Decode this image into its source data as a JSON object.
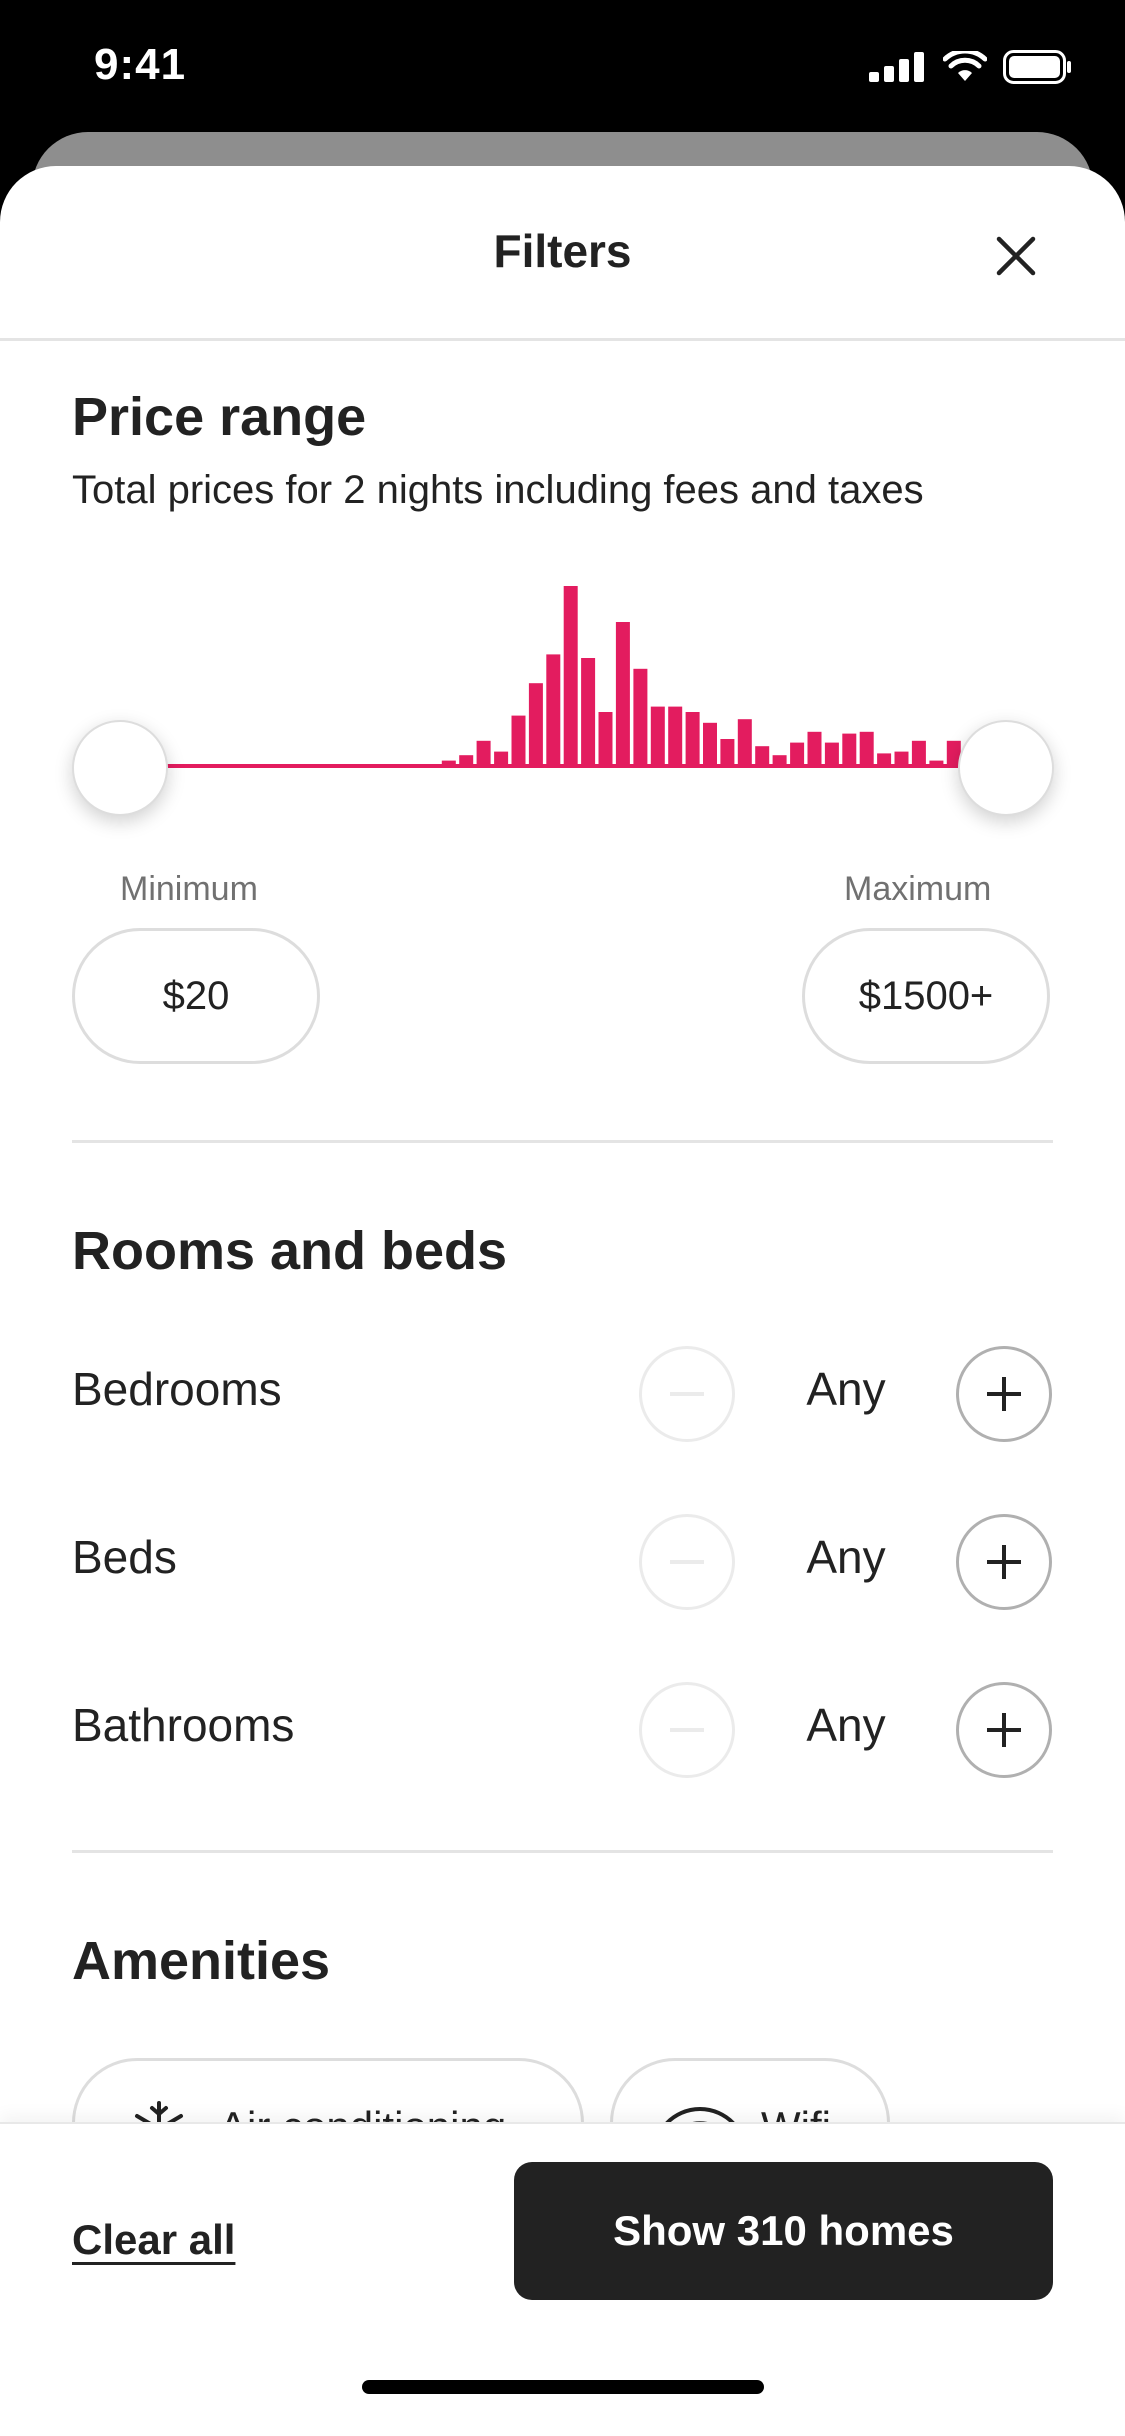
{
  "status_bar": {
    "time": "9:41"
  },
  "header": {
    "title": "Filters"
  },
  "price_range": {
    "title": "Price range",
    "subtitle": "Total prices for 2 nights including fees and taxes",
    "min_label": "Minimum",
    "max_label": "Maximum",
    "min_value": "$20",
    "max_value": "$1500+",
    "slider_min_fraction": 0.0,
    "slider_max_fraction": 1.0,
    "histogram_relative_heights": [
      0,
      0,
      0,
      0,
      0,
      0,
      0,
      0,
      0,
      0,
      0,
      0,
      0,
      0,
      0,
      0,
      0,
      0,
      0,
      0.03,
      0.06,
      0.14,
      0.08,
      0.28,
      0.46,
      0.62,
      1.0,
      0.6,
      0.3,
      0.8,
      0.54,
      0.33,
      0.33,
      0.3,
      0.24,
      0.15,
      0.26,
      0.11,
      0.06,
      0.13,
      0.19,
      0.13,
      0.18,
      0.19,
      0.07,
      0.08,
      0.14,
      0.03,
      0.14,
      0.05,
      0.02,
      0.2
    ],
    "accent_color": "#E31C5F"
  },
  "rooms": {
    "title": "Rooms and beds",
    "rows": [
      {
        "label": "Bedrooms",
        "value": "Any"
      },
      {
        "label": "Beds",
        "value": "Any"
      },
      {
        "label": "Bathrooms",
        "value": "Any"
      }
    ]
  },
  "amenities": {
    "title": "Amenities",
    "chips": [
      {
        "label": "Air conditioning",
        "icon": "snowflake-icon"
      },
      {
        "label": "Wifi",
        "icon": "wifi-icon"
      }
    ]
  },
  "footer": {
    "clear_label": "Clear all",
    "show_label": "Show 310 homes"
  }
}
